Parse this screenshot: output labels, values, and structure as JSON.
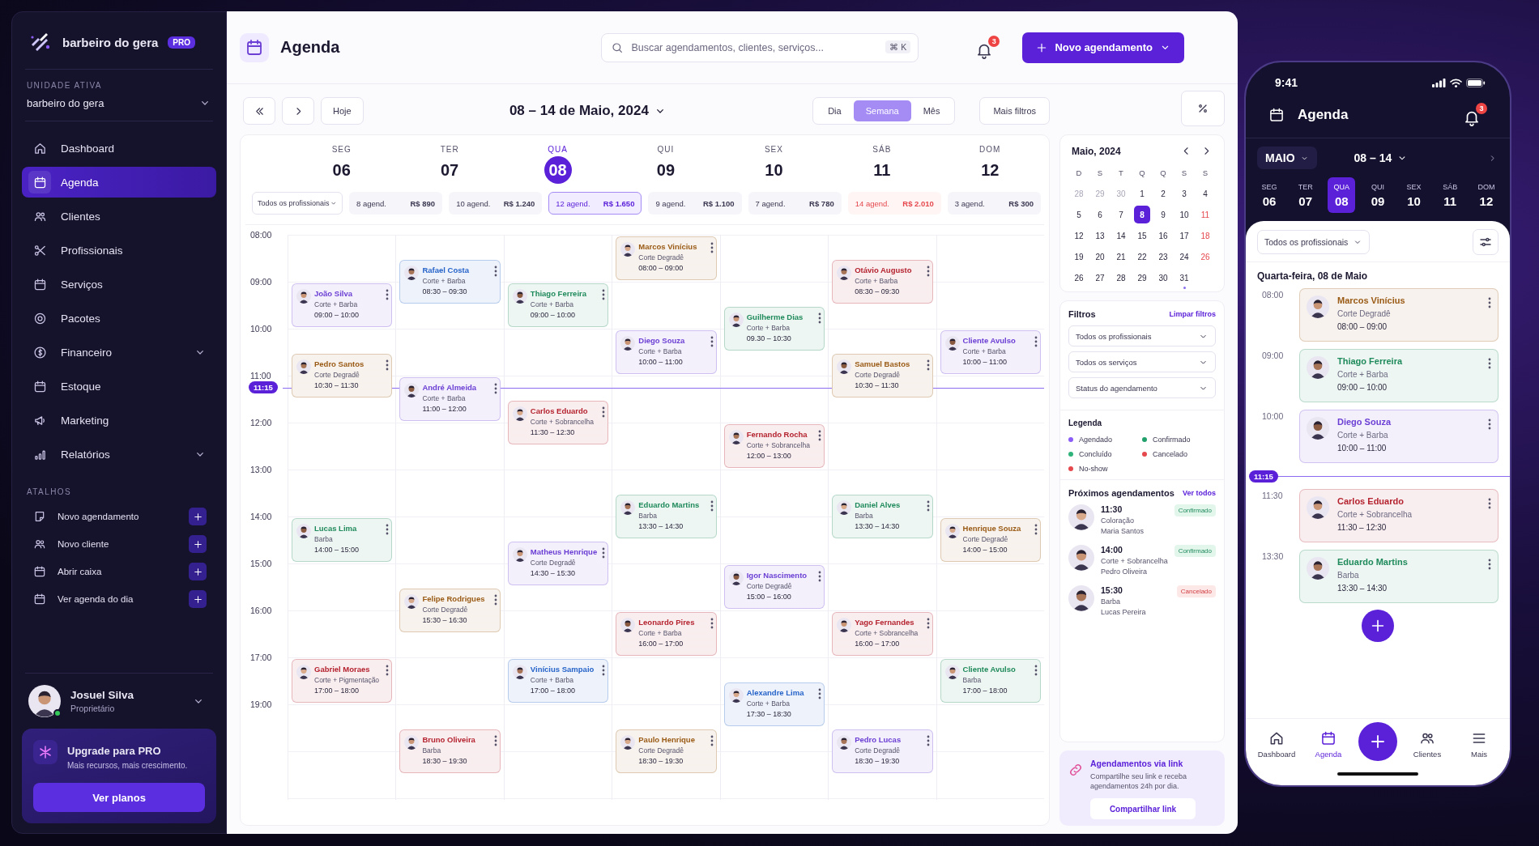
{
  "sidebar": {
    "brand": {
      "name": "barbeiro do gera",
      "badge": "PRO"
    },
    "unit": {
      "label": "UNIDADE ATIVA",
      "value": "barbeiro do gera"
    },
    "nav": [
      {
        "label": "Dashboard",
        "kind": "link",
        "selected": false
      },
      {
        "label": "Agenda",
        "kind": "link",
        "selected": true
      },
      {
        "label": "Clientes",
        "kind": "link",
        "selected": false
      },
      {
        "label": "Profissionais",
        "kind": "link",
        "selected": false
      },
      {
        "label": "Serviços",
        "kind": "link",
        "selected": false
      },
      {
        "label": "Pacotes",
        "kind": "link",
        "selected": false
      },
      {
        "label": "Financeiro",
        "kind": "group",
        "selected": false
      },
      {
        "label": "Estoque",
        "kind": "link",
        "selected": false
      },
      {
        "label": "Marketing",
        "kind": "link",
        "selected": false
      },
      {
        "label": "Relatórios",
        "kind": "group",
        "selected": false
      }
    ],
    "shortcuts_title": "ATALHOS",
    "shortcuts": [
      {
        "label": "Novo agendamento"
      },
      {
        "label": "Novo cliente"
      },
      {
        "label": "Abrir caixa"
      },
      {
        "label": "Ver agenda do dia"
      }
    ],
    "user": {
      "name": "Josuel Silva",
      "role": "Proprietário",
      "online": true
    },
    "upgrade": {
      "title": "Upgrade para PRO",
      "text": "Mais recursos, mais crescimento.",
      "button": "Ver planos"
    }
  },
  "header": {
    "title": "Agenda",
    "search": {
      "placeholder": "Buscar agendamentos, clientes, serviços...",
      "shortcut": "⌘ K"
    },
    "notifications": "3",
    "new_button": "Novo agendamento"
  },
  "toolbar": {
    "today": "Hoje",
    "range": "08 – 14 de Maio, 2024",
    "views": [
      {
        "label": "Dia",
        "selected": false
      },
      {
        "label": "Semana",
        "selected": true
      },
      {
        "label": "Mês",
        "selected": false
      }
    ],
    "more_filters": "Mais filtros"
  },
  "calendar": {
    "professional_filter": "Todos os profissionais",
    "now": "11:15",
    "hours": [
      "08:00",
      "09:00",
      "10:00",
      "11:00",
      "12:00",
      "13:00",
      "14:00",
      "15:00",
      "16:00",
      "17:00",
      "19:00"
    ],
    "days": [
      {
        "weekday": "SEG",
        "number": "06",
        "selected": false,
        "count": "8 agend.",
        "total": "R$ 890",
        "alert": false,
        "events": [
          {
            "name": "João Silva",
            "service": "Corte + Barba",
            "time": "09:00 – 10:00",
            "color": "#6b3fd4"
          },
          {
            "name": "Pedro Santos",
            "service": "Corte Degradê",
            "time": "10:30 – 11:30",
            "color": "#9a5b16"
          },
          {
            "name": "Lucas Lima",
            "service": "Barba",
            "time": "14:00 – 15:00",
            "color": "#1f8a5b"
          },
          {
            "name": "Gabriel Moraes",
            "service": "Corte + Pigmentação",
            "time": "17:00 – 18:00",
            "color": "#b4232f"
          }
        ]
      },
      {
        "weekday": "TER",
        "number": "07",
        "selected": false,
        "count": "10 agend.",
        "total": "R$ 1.240",
        "alert": false,
        "events": [
          {
            "name": "Rafael Costa",
            "service": "Corte + Barba",
            "time": "08:30 – 09:30",
            "color": "#2563c9"
          },
          {
            "name": "André Almeida",
            "service": "Corte + Barba",
            "time": "11:00 – 12:00",
            "color": "#6b3fd4"
          },
          {
            "name": "Felipe Rodrigues",
            "service": "Corte Degradê",
            "time": "15:30 – 16:30",
            "color": "#9a5b16"
          },
          {
            "name": "Bruno Oliveira",
            "service": "Barba",
            "time": "18:30 – 19:30",
            "color": "#b4232f"
          }
        ]
      },
      {
        "weekday": "QUA",
        "number": "08",
        "selected": true,
        "count": "12 agend.",
        "total": "R$ 1.650",
        "alert": false,
        "events": [
          {
            "name": "Thiago Ferreira",
            "service": "Corte + Barba",
            "time": "09:00 – 10:00",
            "color": "#1f8a5b"
          },
          {
            "name": "Carlos Eduardo",
            "service": "Corte + Sobrancelha",
            "time": "11:30 – 12:30",
            "color": "#b4232f"
          },
          {
            "name": "Matheus Henrique",
            "service": "Corte Degradê",
            "time": "14:30 – 15:30",
            "color": "#6b3fd4"
          },
          {
            "name": "Vinícius Sampaio",
            "service": "Corte + Barba",
            "time": "17:00 – 18:00",
            "color": "#2563c9"
          }
        ]
      },
      {
        "weekday": "QUI",
        "number": "09",
        "selected": false,
        "count": "9 agend.",
        "total": "R$ 1.100",
        "alert": false,
        "events": [
          {
            "name": "Marcos Vinícius",
            "service": "Corte Degradê",
            "time": "08:00 – 09:00",
            "color": "#9a5b16"
          },
          {
            "name": "Diego Souza",
            "service": "Corte + Barba",
            "time": "10:00 – 11:00",
            "color": "#6b3fd4"
          },
          {
            "name": "Eduardo Martins",
            "service": "Barba",
            "time": "13:30 – 14:30",
            "color": "#1f8a5b"
          },
          {
            "name": "Leonardo Pires",
            "service": "Corte + Barba",
            "time": "16:00 – 17:00",
            "color": "#b4232f"
          },
          {
            "name": "Paulo Henrique",
            "service": "Corte Degradê",
            "time": "18:30 – 19:30",
            "color": "#9a5b16"
          }
        ]
      },
      {
        "weekday": "SEX",
        "number": "10",
        "selected": false,
        "count": "7 agend.",
        "total": "R$ 780",
        "alert": false,
        "events": [
          {
            "name": "Guilherme Dias",
            "service": "Corte + Barba",
            "time": "09.30 – 10:30",
            "color": "#1f8a5b"
          },
          {
            "name": "Fernando Rocha",
            "service": "Corte + Sobrancelha",
            "time": "12:00 – 13:00",
            "color": "#b4232f"
          },
          {
            "name": "Igor Nascimento",
            "service": "Corte Degradê",
            "time": "15:00 – 16:00",
            "color": "#6b3fd4"
          },
          {
            "name": "Alexandre Lima",
            "service": "Corte + Barba",
            "time": "17:30 – 18:30",
            "color": "#2563c9"
          }
        ]
      },
      {
        "weekday": "SÁB",
        "number": "11",
        "selected": false,
        "count": "14 agend.",
        "total": "R$ 2.010",
        "alert": true,
        "events": [
          {
            "name": "Otávio Augusto",
            "service": "Corte + Barba",
            "time": "08:30 – 09:30",
            "color": "#b4232f"
          },
          {
            "name": "Samuel Bastos",
            "service": "Corte Degradê",
            "time": "10:30 – 11:30",
            "color": "#9a5b16"
          },
          {
            "name": "Daniel Alves",
            "service": "Barba",
            "time": "13:30 – 14:30",
            "color": "#1f8a5b"
          },
          {
            "name": "Yago Fernandes",
            "service": "Corte + Sobrancelha",
            "time": "16:00 – 17:00",
            "color": "#b4232f"
          },
          {
            "name": "Pedro Lucas",
            "service": "Corte Degradê",
            "time": "18:30 – 19:30",
            "color": "#6b3fd4"
          }
        ]
      },
      {
        "weekday": "DOM",
        "number": "12",
        "selected": false,
        "count": "3 agend.",
        "total": "R$ 300",
        "alert": false,
        "events": [
          {
            "name": "Cliente Avulso",
            "service": "Corte + Barba",
            "time": "10:00 – 11:00",
            "color": "#6b3fd4"
          },
          {
            "name": "Henrique Souza",
            "service": "Corte Degradê",
            "time": "14:00 – 15:00",
            "color": "#9a5b16"
          },
          {
            "name": "Cliente Avulso",
            "service": "Barba",
            "time": "17:00 – 18:00",
            "color": "#1f8a5b"
          }
        ]
      }
    ]
  },
  "mini_calendar": {
    "title": "Maio, 2024",
    "weekdays": [
      "D",
      "S",
      "T",
      "Q",
      "Q",
      "S",
      "S"
    ],
    "weeks": [
      [
        {
          "label": "28",
          "muted": true,
          "selected": false,
          "alert": false,
          "dot": false
        },
        {
          "label": "29",
          "muted": true,
          "selected": false,
          "alert": false,
          "dot": false
        },
        {
          "label": "30",
          "muted": true,
          "selected": false,
          "alert": false,
          "dot": false
        },
        {
          "label": "1",
          "muted": false,
          "selected": false,
          "alert": false,
          "dot": false
        },
        {
          "label": "2",
          "muted": false,
          "selected": false,
          "alert": false,
          "dot": false
        },
        {
          "label": "3",
          "muted": false,
          "selected": false,
          "alert": false,
          "dot": false
        },
        {
          "label": "4",
          "muted": false,
          "selected": false,
          "alert": false,
          "dot": false
        }
      ],
      [
        {
          "label": "5",
          "muted": false,
          "selected": false,
          "alert": false,
          "dot": false
        },
        {
          "label": "6",
          "muted": false,
          "selected": false,
          "alert": false,
          "dot": false
        },
        {
          "label": "7",
          "muted": false,
          "selected": false,
          "alert": false,
          "dot": false
        },
        {
          "label": "8",
          "muted": false,
          "selected": true,
          "alert": false,
          "dot": false
        },
        {
          "label": "9",
          "muted": false,
          "selected": false,
          "alert": false,
          "dot": false
        },
        {
          "label": "10",
          "muted": false,
          "selected": false,
          "alert": false,
          "dot": false
        },
        {
          "label": "11",
          "muted": false,
          "selected": false,
          "alert": true,
          "dot": false
        }
      ],
      [
        {
          "label": "12",
          "muted": false,
          "selected": false,
          "alert": false,
          "dot": false
        },
        {
          "label": "13",
          "muted": false,
          "selected": false,
          "alert": false,
          "dot": false
        },
        {
          "label": "14",
          "muted": false,
          "selected": false,
          "alert": false,
          "dot": false
        },
        {
          "label": "15",
          "muted": false,
          "selected": false,
          "alert": false,
          "dot": false
        },
        {
          "label": "16",
          "muted": false,
          "selected": false,
          "alert": false,
          "dot": false
        },
        {
          "label": "17",
          "muted": false,
          "selected": false,
          "alert": false,
          "dot": false
        },
        {
          "label": "18",
          "muted": false,
          "selected": false,
          "alert": true,
          "dot": false
        }
      ],
      [
        {
          "label": "19",
          "muted": false,
          "selected": false,
          "alert": false,
          "dot": false
        },
        {
          "label": "20",
          "muted": false,
          "selected": false,
          "alert": false,
          "dot": false
        },
        {
          "label": "21",
          "muted": false,
          "selected": false,
          "alert": false,
          "dot": false
        },
        {
          "label": "22",
          "muted": false,
          "selected": false,
          "alert": false,
          "dot": false
        },
        {
          "label": "23",
          "muted": false,
          "selected": false,
          "alert": false,
          "dot": false
        },
        {
          "label": "24",
          "muted": false,
          "selected": false,
          "alert": false,
          "dot": false
        },
        {
          "label": "26",
          "muted": false,
          "selected": false,
          "alert": true,
          "dot": false
        }
      ],
      [
        {
          "label": "26",
          "muted": false,
          "selected": false,
          "alert": false,
          "dot": false
        },
        {
          "label": "27",
          "muted": false,
          "selected": false,
          "alert": false,
          "dot": false
        },
        {
          "label": "28",
          "muted": false,
          "selected": false,
          "alert": false,
          "dot": false
        },
        {
          "label": "29",
          "muted": false,
          "selected": false,
          "alert": false,
          "dot": false
        },
        {
          "label": "30",
          "muted": false,
          "selected": false,
          "alert": false,
          "dot": false
        },
        {
          "label": "31",
          "muted": false,
          "selected": false,
          "alert": false,
          "dot": true
        }
      ]
    ]
  },
  "filters": {
    "title": "Filtros",
    "clear": "Limpar filtros",
    "selects": [
      "Todos os profissionais",
      "Todos os serviços",
      "Status do agendamento"
    ]
  },
  "legend": {
    "title": "Legenda",
    "items": [
      {
        "label": "Agendado",
        "color": "#8b5cf6"
      },
      {
        "label": "Confirmado",
        "color": "#22a06b"
      },
      {
        "label": "Concluído",
        "color": "#2fb37a"
      },
      {
        "label": "Cancelado",
        "color": "#e5484d"
      },
      {
        "label": "No-show",
        "color": "#e5484d"
      }
    ]
  },
  "upcoming": {
    "title": "Próximos agendamentos",
    "link": "Ver todos",
    "items": [
      {
        "time": "11:30",
        "service": "Coloração",
        "client": "Maria Santos",
        "status": "Confirmado",
        "kind": "confirmed"
      },
      {
        "time": "14:00",
        "service": "Corte + Sobrancelha",
        "client": "Pedro Oliveira",
        "status": "Confirmado",
        "kind": "confirmed"
      },
      {
        "time": "15:30",
        "service": "Barba",
        "client": "Lucas Pereira",
        "status": "Cancelado",
        "kind": "cancelled"
      }
    ]
  },
  "share": {
    "title": "Agendamentos via link",
    "text": "Compartilhe seu link e receba agendamentos 24h por dia.",
    "button": "Compartilhar link"
  },
  "phone": {
    "clock": "9:41",
    "title": "Agenda",
    "notifications": "3",
    "month": "MAIO",
    "range": "08 – 14",
    "week": [
      {
        "weekday": "SEG",
        "number": "06",
        "selected": false
      },
      {
        "weekday": "TER",
        "number": "07",
        "selected": false
      },
      {
        "weekday": "QUA",
        "number": "08",
        "selected": true
      },
      {
        "weekday": "QUI",
        "number": "09",
        "selected": false
      },
      {
        "weekday": "SEX",
        "number": "10",
        "selected": false
      },
      {
        "weekday": "SÁB",
        "number": "11",
        "selected": false
      },
      {
        "weekday": "DOM",
        "number": "12",
        "selected": false
      }
    ],
    "filter": "Todos os profissionais",
    "date_title": "Quarta-feira, 08 de Maio",
    "schedule": [
      {
        "kind": "event",
        "time": "08:00",
        "name": "Marcos Vinícius",
        "service": "Corte Degradê",
        "range": "08:00 – 09:00",
        "color": "#9a5b16"
      },
      {
        "kind": "event",
        "time": "09:00",
        "name": "Thiago Ferreira",
        "service": "Corte + Barba",
        "range": "09:00 – 10:00",
        "color": "#1f8a5b"
      },
      {
        "kind": "event",
        "time": "10:00",
        "name": "Diego Souza",
        "service": "Corte + Barba",
        "range": "10:00 – 11:00",
        "color": "#6b3fd4"
      },
      {
        "kind": "now",
        "time": "11:15"
      },
      {
        "kind": "event",
        "time": "11:30",
        "name": "Carlos Eduardo",
        "service": "Corte + Sobrancelha",
        "range": "11:30 – 12:30",
        "color": "#b4232f"
      },
      {
        "kind": "event",
        "time": "13:30",
        "name": "Eduardo Martins",
        "service": "Barba",
        "range": "13:30 – 14:30",
        "color": "#1f8a5b"
      }
    ],
    "tabs": [
      {
        "kind": "tab",
        "label": "Dashboard",
        "selected": false
      },
      {
        "kind": "tab",
        "label": "Agenda",
        "selected": true
      },
      {
        "kind": "action"
      },
      {
        "kind": "tab",
        "label": "Clientes",
        "selected": false
      },
      {
        "kind": "tab",
        "label": "Mais",
        "selected": false
      }
    ]
  }
}
